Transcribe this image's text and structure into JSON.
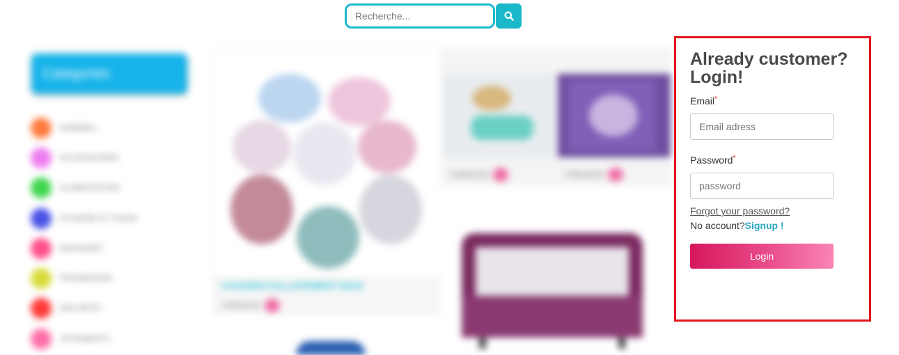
{
  "search": {
    "placeholder": "Recherche...",
    "icon": "search-icon"
  },
  "sidebar": {
    "title": "Categories",
    "items": [
      {
        "label": "SOMMEIL",
        "color": "#ff7a3d"
      },
      {
        "label": "ACCESSOIRES",
        "color": "#ee7df0"
      },
      {
        "label": "ALIMENTATION",
        "color": "#3fd64f"
      },
      {
        "label": "HYGIENE ET SOINS",
        "color": "#4a52e6"
      },
      {
        "label": "BAIGNADE",
        "color": "#ff4f8a"
      },
      {
        "label": "PROMENADE",
        "color": "#d8dc3a"
      },
      {
        "label": "SECURITE",
        "color": "#ff3a3a"
      },
      {
        "label": "VETEMENTS",
        "color": "#ff6fa8"
      }
    ]
  },
  "products": {
    "big_title": "COUSSIN D'ALLAITEMENT MAXI",
    "price": "3 000,00 DA"
  },
  "login": {
    "title": "Already customer? Login!",
    "email_label": "Email",
    "email_placeholder": "Email adress",
    "required_mark": "*",
    "password_label": "Password",
    "password_placeholder": "password",
    "forgot_link": "Forgot your password?",
    "no_account_text": "No account?",
    "signup_link": "Signup !",
    "login_button": "Login",
    "border_color": "#e3141c"
  }
}
